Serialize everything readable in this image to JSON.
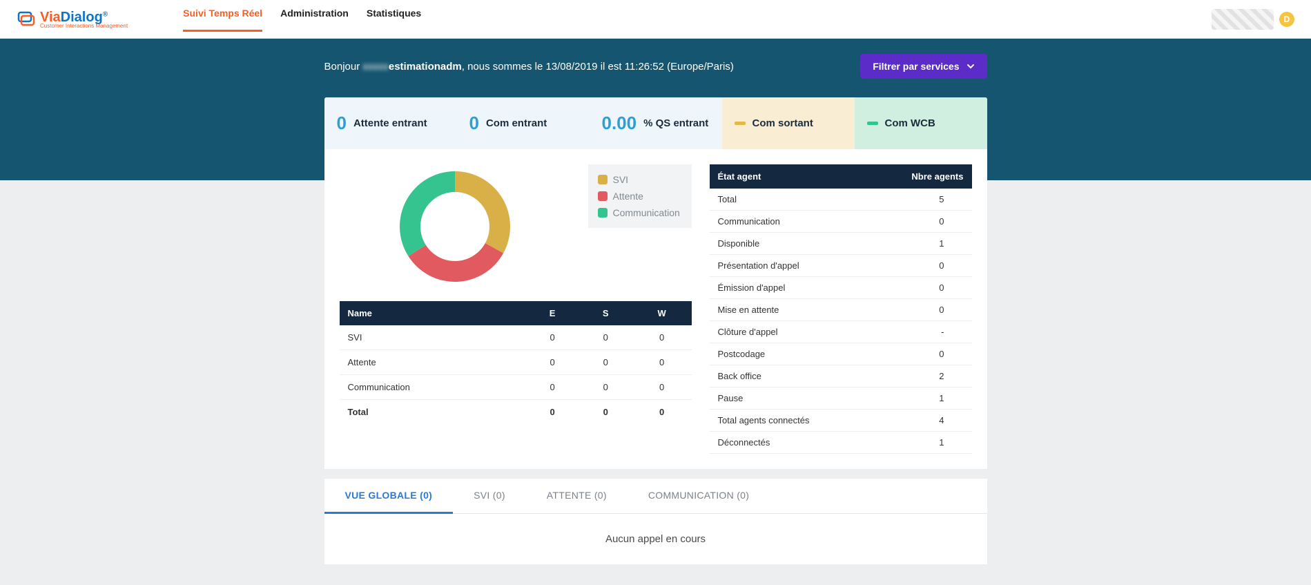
{
  "brand": {
    "via": "Via",
    "dialog": "Dialog",
    "sub": "Customer Interactions Management",
    "reg": "®"
  },
  "nav": {
    "items": [
      {
        "label": "Suivi Temps Réel",
        "active": true
      },
      {
        "label": "Administration",
        "active": false
      },
      {
        "label": "Statistiques",
        "active": false
      }
    ]
  },
  "avatar_letter": "D",
  "greeting": {
    "prefix": "Bonjour ",
    "blur": "xxxxx",
    "username": "estimationadm",
    "suffix": ", nous sommes le 13/08/2019 il est 11:26:52 (Europe/Paris)"
  },
  "filter_button": "Filtrer par services",
  "kpis": [
    {
      "value": "0",
      "label": "Attente entrant"
    },
    {
      "value": "0",
      "label": "Com entrant"
    },
    {
      "value": "0.00",
      "label": "% QS entrant"
    },
    {
      "value": "",
      "label": "Com sortant"
    },
    {
      "value": "",
      "label": "Com WCB"
    }
  ],
  "chart_data": {
    "type": "pie",
    "title": "",
    "series": [
      {
        "name": "SVI",
        "value": 33,
        "color": "#d9b048"
      },
      {
        "name": "Attente",
        "value": 33,
        "color": "#e05a5f"
      },
      {
        "name": "Communication",
        "value": 34,
        "color": "#35c48f"
      }
    ],
    "note": "Donut chart — no data labels visible; proportions are visually approximately equal thirds; hollow center."
  },
  "left_table": {
    "headers": [
      "Name",
      "E",
      "S",
      "W"
    ],
    "rows": [
      {
        "name": "SVI",
        "e": "0",
        "s": "0",
        "w": "0"
      },
      {
        "name": "Attente",
        "e": "0",
        "s": "0",
        "w": "0"
      },
      {
        "name": "Communication",
        "e": "0",
        "s": "0",
        "w": "0"
      }
    ],
    "total": {
      "name": "Total",
      "e": "0",
      "s": "0",
      "w": "0"
    }
  },
  "agent_table": {
    "headers": [
      "État agent",
      "Nbre agents"
    ],
    "rows": [
      {
        "label": "Total",
        "value": "5"
      },
      {
        "label": "Communication",
        "value": "0"
      },
      {
        "label": "Disponible",
        "value": "1"
      },
      {
        "label": "Présentation d'appel",
        "value": "0"
      },
      {
        "label": "Émission d'appel",
        "value": "0"
      },
      {
        "label": "Mise en attente",
        "value": "0"
      },
      {
        "label": "Clôture d'appel",
        "value": "-"
      },
      {
        "label": "Postcodage",
        "value": "0"
      },
      {
        "label": "Back office",
        "value": "2"
      },
      {
        "label": "Pause",
        "value": "1"
      },
      {
        "label": "Total agents connectés",
        "value": "4"
      },
      {
        "label": "Déconnectés",
        "value": "1"
      }
    ]
  },
  "tabs": {
    "items": [
      {
        "label": "VUE GLOBALE (0)",
        "active": true
      },
      {
        "label": "SVI (0)",
        "active": false
      },
      {
        "label": "ATTENTE (0)",
        "active": false
      },
      {
        "label": "COMMUNICATION (0)",
        "active": false
      }
    ],
    "empty_text": "Aucun appel en cours"
  },
  "colors": {
    "svi": "#d9b048",
    "attente": "#e05a5f",
    "communication": "#35c48f",
    "hero": "#16556f",
    "navy": "#14283f",
    "accent": "#ff5a1f"
  }
}
